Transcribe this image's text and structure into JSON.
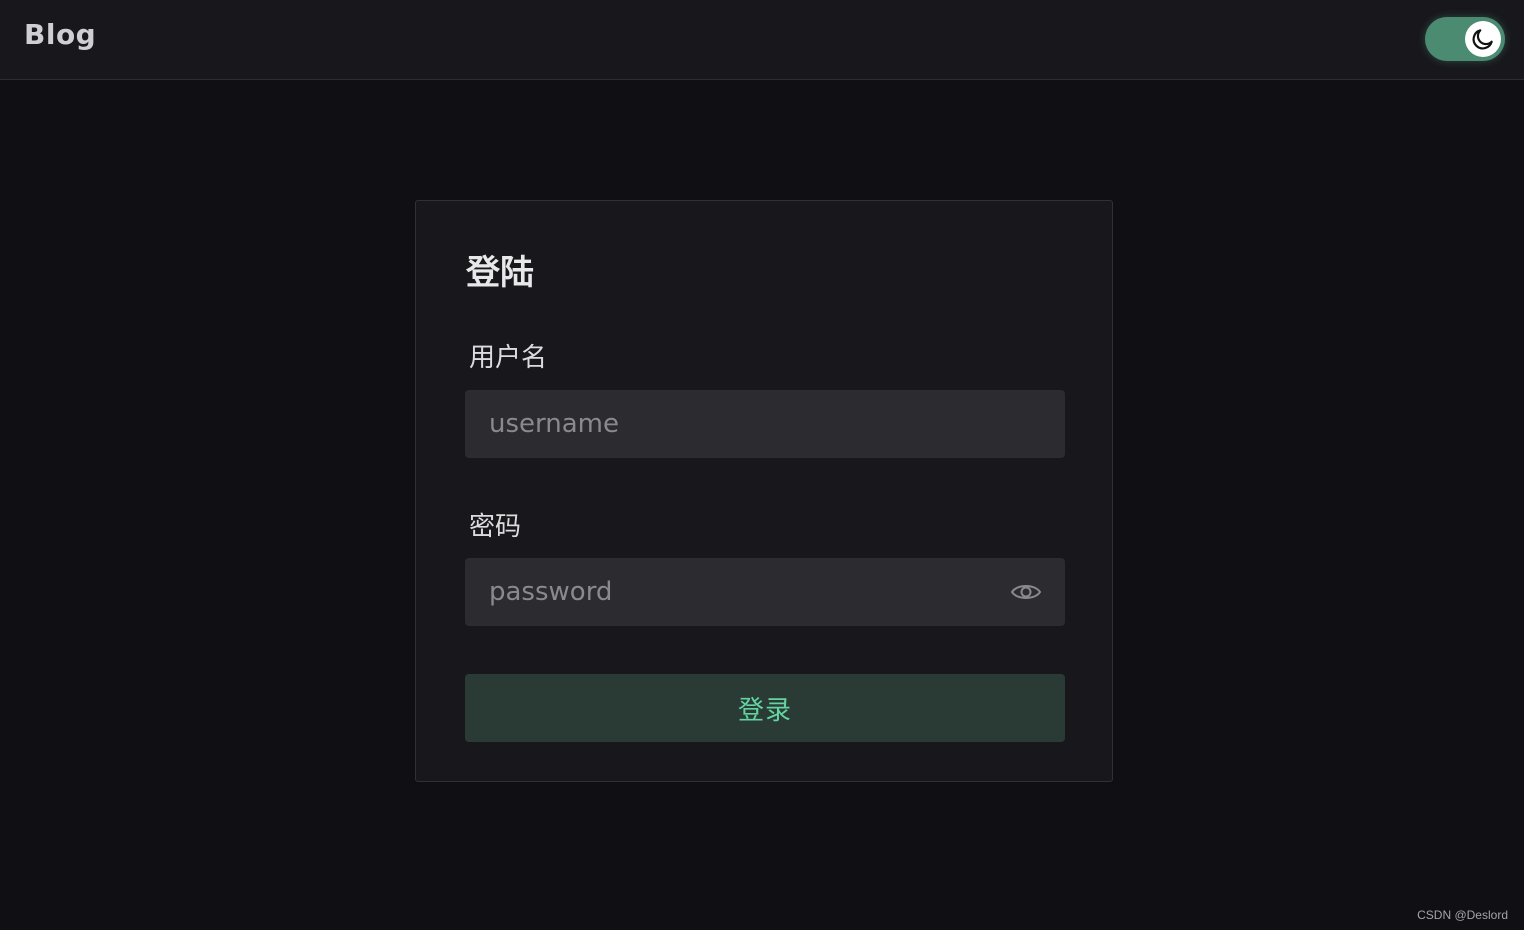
{
  "header": {
    "brand": "Blog",
    "theme_toggle": {
      "state": "dark",
      "icon": "moon-icon",
      "accent": "#4b8b72"
    }
  },
  "login": {
    "title": "登陆",
    "username_label": "用户名",
    "username_placeholder": "username",
    "username_value": "",
    "password_label": "密码",
    "password_placeholder": "password",
    "password_value": "",
    "password_visibility_icon": "eye-icon",
    "submit_label": "登录",
    "submit_color": "#63d3a0"
  },
  "watermark": "CSDN @Deslord"
}
